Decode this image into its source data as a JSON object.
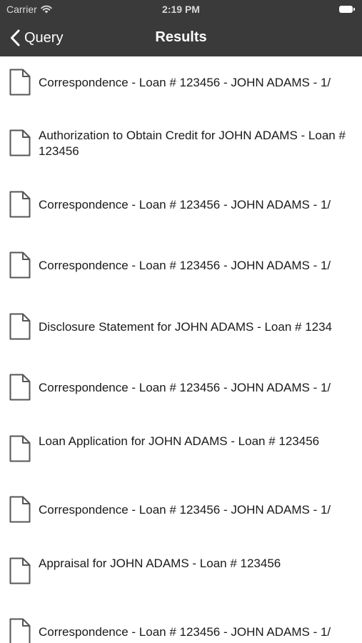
{
  "status_bar": {
    "carrier": "Carrier",
    "time": "2:19 PM"
  },
  "nav": {
    "back_label": "Query",
    "title": "Results"
  },
  "results": [
    {
      "label": "Correspondence - Loan # 123456 - JOHN ADAMS - 1/",
      "icon": "document-icon"
    },
    {
      "label": "Authorization to Obtain Credit for JOHN ADAMS - Loan # 123456",
      "icon": "document-icon"
    },
    {
      "label": "Correspondence - Loan # 123456 - JOHN ADAMS - 1/",
      "icon": "document-icon"
    },
    {
      "label": "Correspondence - Loan # 123456 - JOHN ADAMS - 1/",
      "icon": "document-icon"
    },
    {
      "label": "Disclosure Statement for JOHN ADAMS - Loan # 1234",
      "icon": "document-icon"
    },
    {
      "label": "Correspondence - Loan # 123456 - JOHN ADAMS - 1/",
      "icon": "document-icon"
    },
    {
      "label": "Loan Application for JOHN ADAMS - Loan # 123456",
      "icon": "document-icon"
    },
    {
      "label": "Correspondence - Loan # 123456 - JOHN ADAMS - 1/",
      "icon": "document-icon"
    },
    {
      "label": "Appraisal for JOHN ADAMS - Loan # 123456",
      "icon": "document-icon"
    },
    {
      "label": "Correspondence - Loan # 123456 - JOHN ADAMS - 1/",
      "icon": "document-icon"
    }
  ],
  "colors": {
    "header_bg": "#3a3a3a",
    "header_text": "#ffffff",
    "list_bg": "#ffffff",
    "row_text": "#1a1a1a",
    "icon_stroke": "#555555"
  }
}
